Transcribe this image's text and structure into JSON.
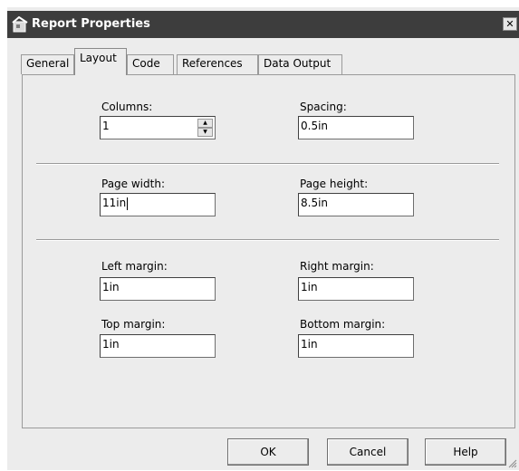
{
  "window": {
    "title": "Report Properties",
    "close_glyph": "✕"
  },
  "tabs": [
    {
      "label": "General"
    },
    {
      "label": "Layout"
    },
    {
      "label": "Code"
    },
    {
      "label": "References"
    },
    {
      "label": "Data Output"
    }
  ],
  "active_tab": "Layout",
  "layout": {
    "columns_label": "Columns:",
    "columns_value": "1",
    "spacing_label": "Spacing:",
    "spacing_value": "0.5in",
    "page_width_label": "Page width:",
    "page_width_value": "11in",
    "page_height_label": "Page height:",
    "page_height_value": "8.5in",
    "left_margin_label": "Left margin:",
    "left_margin_value": "1in",
    "right_margin_label": "Right margin:",
    "right_margin_value": "1in",
    "top_margin_label": "Top margin:",
    "top_margin_value": "1in",
    "bottom_margin_label": "Bottom margin:",
    "bottom_margin_value": "1in"
  },
  "buttons": {
    "ok": "OK",
    "cancel": "Cancel",
    "help": "Help"
  },
  "icons": {
    "title": "report-properties-icon",
    "close": "close-icon",
    "spin_up": "spin-up-icon",
    "spin_down": "spin-down-icon",
    "grip": "resize-grip-icon"
  }
}
